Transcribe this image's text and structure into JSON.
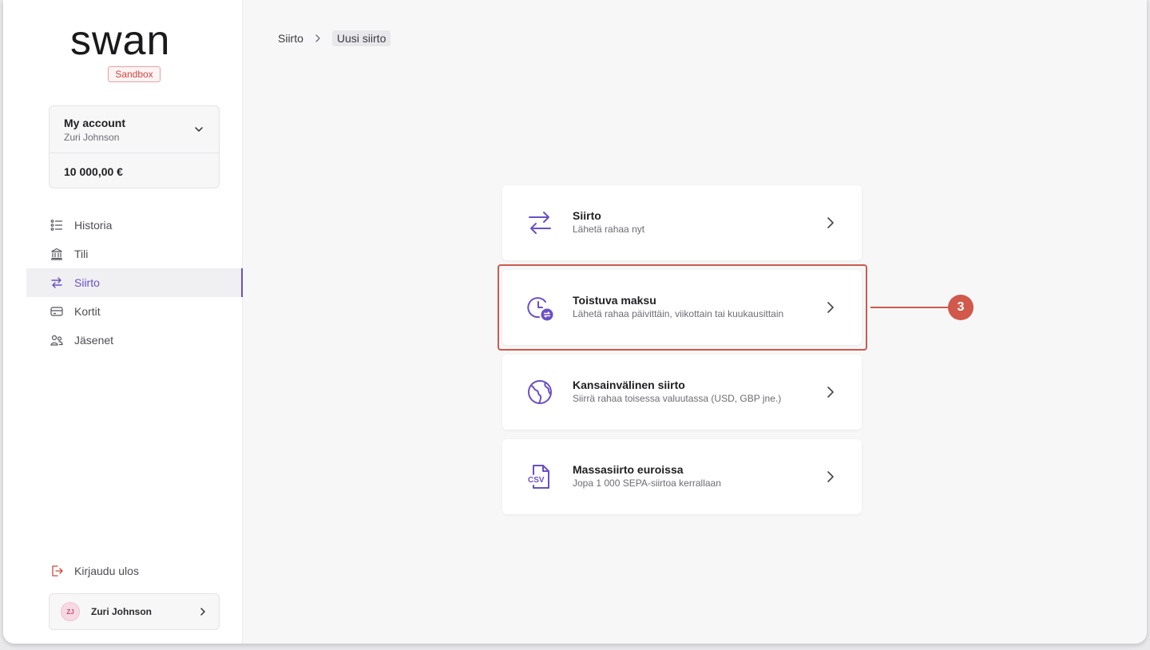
{
  "brand": {
    "logo_text": "swan",
    "env_badge": "Sandbox"
  },
  "account": {
    "name": "My account",
    "owner": "Zuri Johnson",
    "balance": "10 000,00 €"
  },
  "nav": {
    "items": [
      {
        "label": "Historia",
        "icon": "list-icon"
      },
      {
        "label": "Tili",
        "icon": "bank-icon"
      },
      {
        "label": "Siirto",
        "icon": "transfer-arrows-icon",
        "active": true
      },
      {
        "label": "Kortit",
        "icon": "card-icon"
      },
      {
        "label": "Jäsenet",
        "icon": "members-icon"
      }
    ]
  },
  "footer": {
    "logout_label": "Kirjaudu ulos",
    "user": {
      "initials": "ZJ",
      "name": "Zuri Johnson"
    }
  },
  "breadcrumb": {
    "parent": "Siirto",
    "current": "Uusi siirto"
  },
  "options": [
    {
      "title": "Siirto",
      "description": "Lähetä rahaa nyt",
      "icon": "transfer-arrows-icon"
    },
    {
      "title": "Toistuva maksu",
      "description": "Lähetä rahaa päivittäin, viikottain tai kuukausittain",
      "icon": "recurring-clock-icon"
    },
    {
      "title": "Kansainvälinen siirto",
      "description": "Siirrä rahaa toisessa valuutassa (USD, GBP jne.)",
      "icon": "globe-icon"
    },
    {
      "title": "Massasiirto euroissa",
      "description": "Jopa 1 000 SEPA-siirtoa kerrallaan",
      "icon": "csv-file-icon"
    }
  ],
  "annotation": {
    "step": "3"
  },
  "colors": {
    "accent": "#6a4fc7",
    "annotation": "#d0594b",
    "sandbox": "#d2463d"
  }
}
